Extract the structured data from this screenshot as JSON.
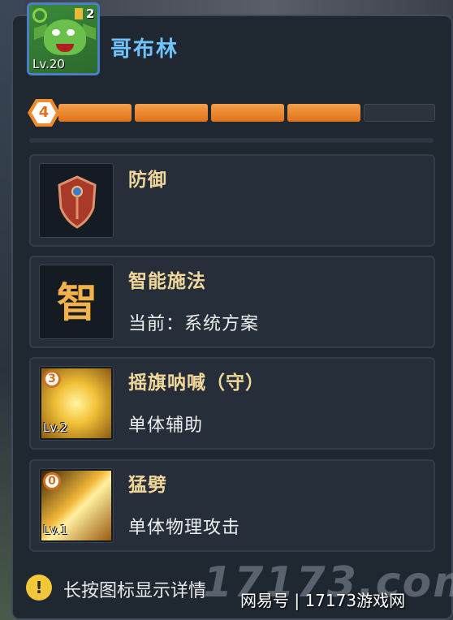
{
  "hero": {
    "name": "哥布林",
    "level_label": "Lv.20",
    "count": "2"
  },
  "progress": {
    "badge_number": "4",
    "segments_total": 5,
    "segments_filled": 4
  },
  "cards": [
    {
      "title": "防御",
      "subtitle": "",
      "icon": "shield-icon"
    },
    {
      "title": "智能施法",
      "subtitle": "当前：系统方案",
      "icon_text": "智",
      "icon": "zhi-icon"
    },
    {
      "title": "摇旗呐喊（守）",
      "subtitle": "单体辅助",
      "cost": "3",
      "level": "Lv.2",
      "icon": "flag-skill-icon"
    },
    {
      "title": "猛劈",
      "subtitle": "单体物理攻击",
      "cost": "0",
      "level": "Lv.1",
      "icon": "axe-skill-icon"
    }
  ],
  "footer": {
    "icon": "exclamation-icon",
    "icon_text": "!",
    "text": "长按图标显示详情"
  },
  "watermark": {
    "big": "17173.com",
    "small": "网易号 | 17173游戏网"
  }
}
